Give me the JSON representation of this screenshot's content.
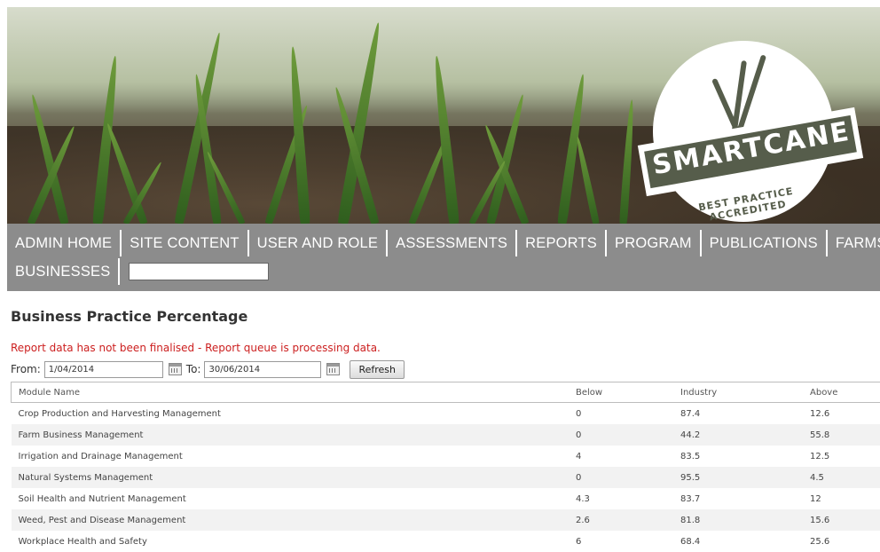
{
  "banner": {
    "logo_text": "SMARTCANE",
    "logo_subtext": "BEST PRACTICE ACCREDITED"
  },
  "nav": {
    "items": [
      "ADMIN HOME",
      "SITE CONTENT",
      "USER AND ROLE",
      "ASSESSMENTS",
      "REPORTS",
      "PROGRAM",
      "PUBLICATIONS",
      "FARMS"
    ],
    "items_row2": [
      "BUSINESSES"
    ],
    "search_value": ""
  },
  "page": {
    "title": "Business Practice Percentage",
    "notice": "Report data has not been finalised - Report queue is processing data."
  },
  "filters": {
    "from_label": "From:",
    "from_value": "1/04/2014",
    "to_label": "To:",
    "to_value": "30/06/2014",
    "refresh_label": "Refresh"
  },
  "table": {
    "headers": [
      "Module Name",
      "Below",
      "Industry",
      "Above"
    ],
    "rows": [
      [
        "Crop Production and Harvesting Management",
        "0",
        "87.4",
        "12.6"
      ],
      [
        "Farm Business Management",
        "0",
        "44.2",
        "55.8"
      ],
      [
        "Irrigation and Drainage Management",
        "4",
        "83.5",
        "12.5"
      ],
      [
        "Natural Systems Management",
        "0",
        "95.5",
        "4.5"
      ],
      [
        "Soil Health and Nutrient Management",
        "4.3",
        "83.7",
        "12"
      ],
      [
        "Weed, Pest and Disease Management",
        "2.6",
        "81.8",
        "15.6"
      ],
      [
        "Workplace Health and Safety",
        "6",
        "68.4",
        "25.6"
      ]
    ]
  },
  "colors": {
    "nav_background": "#8c8c8c",
    "notice_text": "#cc1f1f"
  }
}
